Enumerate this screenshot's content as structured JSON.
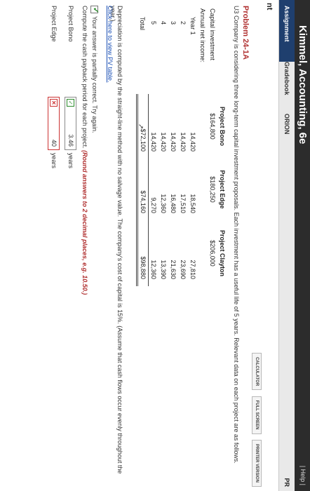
{
  "header": {
    "title": "Kimmel, Accounting, 6e",
    "help": "| Help |"
  },
  "tabs": [
    {
      "label": "Assignment"
    },
    {
      "label": "Gradebook"
    },
    {
      "label": "ORION"
    }
  ],
  "tab_edge": "PR",
  "left_label": "nt",
  "toolbar": {
    "calculator": "CALCULATOR",
    "full_screen": "FULL SCREEN",
    "printer_version": "PRINTER VERSION"
  },
  "problem": {
    "title": "Problem 24-1A",
    "description": "U3 Company is considering three long-term capital investment proposals. Each investment has a useful life of 5 years. Relevant data on each project are as follows."
  },
  "table": {
    "columns": [
      "Project Bono",
      "Project Edge",
      "Project Clayton"
    ],
    "capital_label": "Capital investment",
    "capital": [
      "$164,800",
      "$180,250",
      "$206,000"
    ],
    "annual_label": "Annual net income:",
    "years": [
      {
        "label": "Year  1",
        "values": [
          "14,420",
          "18,540",
          "27,810"
        ]
      },
      {
        "label": "2",
        "values": [
          "14,420",
          "17,510",
          "23,690"
        ]
      },
      {
        "label": "3",
        "values": [
          "14,420",
          "16,480",
          "21,630"
        ]
      },
      {
        "label": "4",
        "values": [
          "14,420",
          "12,360",
          "13,390"
        ]
      },
      {
        "label": "5",
        "values": [
          "14,420",
          "9,270",
          "12,360"
        ]
      }
    ],
    "total_label": "Total",
    "totals": [
      "$72,100",
      "$74,160",
      "$98,880"
    ]
  },
  "note": "Depreciation is computed by the straight-line method with no salvage value. The company's cost of capital is 15%. (Assume that cash flows occur evenly throughout the year.)",
  "link": "Click here to view PV table.",
  "feedback": "Your answer is partially correct.  Try again.",
  "instruction": {
    "text": "Compute the cash payback period for each project.",
    "emphasis": "(Round answers to 2 decimal places, e.g. 10.50.)"
  },
  "answers": [
    {
      "label": "Project Bono",
      "value": "3.46",
      "units": "years",
      "status": "correct"
    },
    {
      "label": "Project Edge",
      "value": "40",
      "units": "years",
      "status": "incorrect"
    }
  ]
}
